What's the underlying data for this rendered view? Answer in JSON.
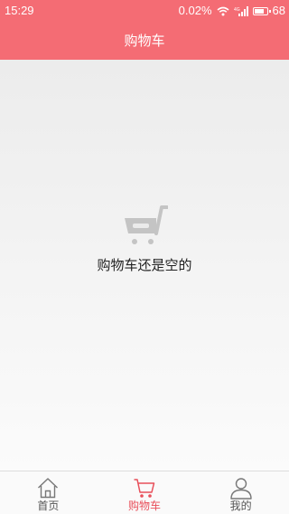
{
  "status_bar": {
    "time": "15:29",
    "network_speed": "0.02%",
    "battery_level": "68",
    "icons": [
      "wifi-icon",
      "signal-icon",
      "battery-icon"
    ]
  },
  "header": {
    "title": "购物车"
  },
  "empty_state": {
    "icon": "empty-cart-icon",
    "message": "购物车还是空的"
  },
  "tab_bar": {
    "tabs": [
      {
        "label": "首页",
        "icon": "home-icon",
        "active": false
      },
      {
        "label": "购物车",
        "icon": "cart-icon",
        "active": true
      },
      {
        "label": "我的",
        "icon": "user-icon",
        "active": false
      }
    ]
  },
  "colors": {
    "brand": "#f46c74",
    "active_tab": "#e8505b",
    "icon_gray": "#c4c4c4",
    "text_dark": "#222222",
    "text_gray": "#555555"
  }
}
